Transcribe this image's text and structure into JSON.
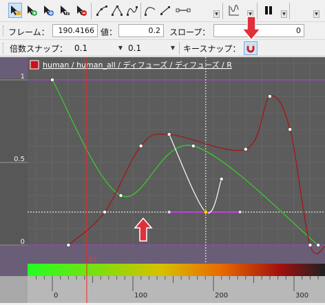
{
  "toolbar": {
    "tools": [
      {
        "name": "key-select-tool-icon"
      },
      {
        "name": "key-add-tool-icon"
      },
      {
        "name": "key-move-tool-icon"
      },
      {
        "name": "key-scale-tool-icon"
      },
      {
        "name": "key-delete-tool-icon"
      },
      {
        "name": "tangent-linear-icon"
      },
      {
        "name": "tangent-peak-icon"
      },
      {
        "name": "tangent-spline-icon"
      },
      {
        "name": "tangent-ease-icon"
      },
      {
        "name": "tangent-step-icon"
      },
      {
        "name": "curve-view-icon"
      },
      {
        "name": "pause-icon"
      }
    ]
  },
  "value_bar": {
    "frame_label": "フレーム：",
    "frame_value": "190.4166",
    "value_label": "値：",
    "value_value": "0.2",
    "slope_label": "スロープ：",
    "slope_value": "0"
  },
  "snap_bar": {
    "multiple_snap_label": "倍数スナップ：",
    "snap_x": "0.1",
    "snap_y": "0.1",
    "key_snap_label": "キースナップ：",
    "magnet_icon": "magnet-icon"
  },
  "graph": {
    "curve_path": "human / human_all / ディフューズ / ディフューズ / R",
    "curve_color": "#cc1020",
    "current_frame": "47",
    "y_ticks": [
      "1",
      "0.5",
      "0"
    ],
    "x_ticks": [
      "0",
      "100",
      "200",
      "300"
    ],
    "selected_key_frame": 190.4166,
    "selected_key_value": 0.2
  },
  "curves": {
    "red": {
      "color": "#aa1010",
      "keys": [
        [
          20,
          0
        ],
        [
          65,
          0.2
        ],
        [
          110,
          0.6
        ],
        [
          145,
          0.67
        ],
        [
          240,
          0.58
        ],
        [
          270,
          0.9
        ],
        [
          295,
          0.7
        ],
        [
          320,
          0
        ],
        [
          340,
          0
        ]
      ]
    },
    "green": {
      "color": "#3ccf2c",
      "keys": [
        [
          0,
          1
        ],
        [
          85,
          0.3
        ],
        [
          175,
          0.6
        ],
        [
          330,
          0
        ]
      ]
    },
    "white": {
      "color": "#ffffff",
      "keys": [
        [
          145,
          0.67
        ],
        [
          190.4166,
          0.2
        ],
        [
          210,
          0.4
        ]
      ]
    }
  },
  "annotations": {
    "arrow_color": "#e0303a"
  }
}
